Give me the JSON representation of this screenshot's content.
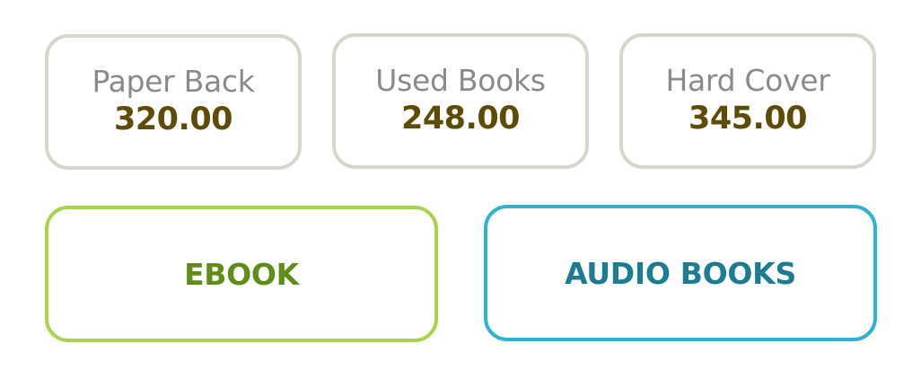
{
  "price_cards": [
    {
      "label": "Paper Back",
      "price": "320.00"
    },
    {
      "label": "Used Books",
      "price": "248.00"
    },
    {
      "label": "Hard Cover",
      "price": "345.00"
    }
  ],
  "formats": {
    "ebook_label": "EBOOK",
    "audio_label": "AUDIO BOOKS"
  },
  "colors": {
    "card_border": "#d6d6cc",
    "price_text": "#5e4b06",
    "ebook_accent": "#a8d34e",
    "audio_accent": "#2fb3d3"
  }
}
